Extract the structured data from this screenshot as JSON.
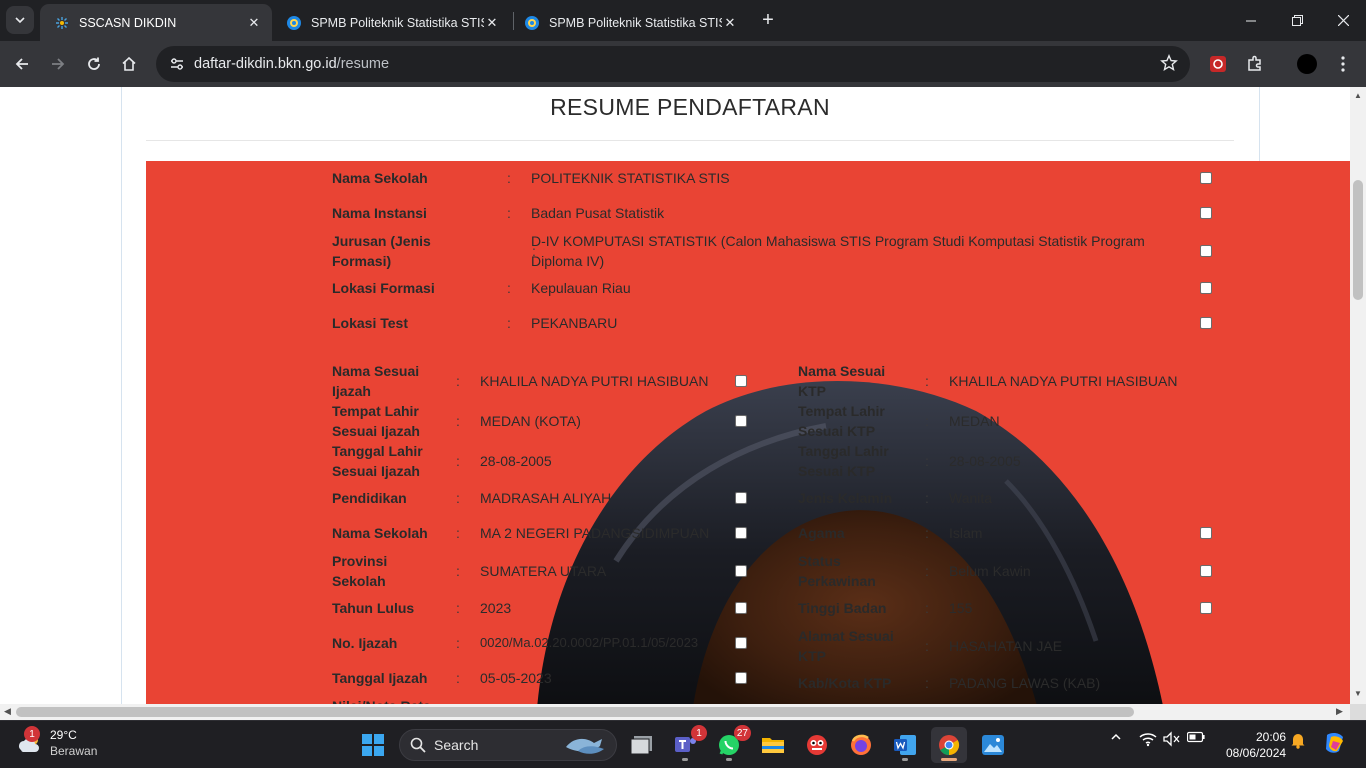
{
  "browser": {
    "tabs": [
      {
        "title": "SSCASN DIKDIN",
        "active": true
      },
      {
        "title": "SPMB Politeknik Statistika STIS",
        "active": false
      },
      {
        "title": "SPMB Politeknik Statistika STIS",
        "active": false
      }
    ],
    "url_host": "daftar-dikdin.bkn.go.id",
    "url_path": "/resume"
  },
  "page": {
    "title": "RESUME PENDAFTARAN",
    "panel_color": "#e94434",
    "top_rows": [
      {
        "label": "Nama Sekolah",
        "value": "POLITEKNIK STATISTIKA STIS"
      },
      {
        "label": "Nama Instansi",
        "value": "Badan Pusat Statistik"
      },
      {
        "label": "Jurusan (Jenis Formasi)",
        "value": "D-IV KOMPUTASI STATISTIK (Calon Mahasiswa STIS Program Studi Komputasi Statistik Program Diploma IV)"
      },
      {
        "label": "Lokasi Formasi",
        "value": "Kepulauan Riau"
      },
      {
        "label": "Lokasi Test",
        "value": "PEKANBARU"
      }
    ],
    "left_rows": [
      {
        "label": "Nama Sesuai Ijazah",
        "value": "KHALILA NADYA PUTRI HASIBUAN"
      },
      {
        "label": "Tempat Lahir Sesuai Ijazah",
        "value": "MEDAN (KOTA)"
      },
      {
        "label": "Tanggal Lahir Sesuai Ijazah",
        "value": "28-08-2005"
      },
      {
        "label": "Pendidikan",
        "value": "MADRASAH ALIYAH"
      },
      {
        "label": "Nama Sekolah",
        "value": "MA 2 NEGERI PADANGSIDIMPUAN"
      },
      {
        "label": "Provinsi Sekolah",
        "value": "SUMATERA UTARA"
      },
      {
        "label": "Tahun Lulus",
        "value": "2023"
      },
      {
        "label": "No. Ijazah",
        "value": "0020/Ma.02.20.0002/PP.01.1/05/2023"
      },
      {
        "label": "Tanggal Ijazah",
        "value": "05-05-2023"
      },
      {
        "label": "Nilai/Nota Rata",
        "value": ""
      }
    ],
    "right_rows": [
      {
        "label": "Nama Sesuai KTP",
        "value": "KHALILA NADYA PUTRI HASIBUAN"
      },
      {
        "label": "Tempat Lahir Sesuai KTP",
        "value": "MEDAN"
      },
      {
        "label": "Tanggal Lahir Sesuai KTP",
        "value": "28-08-2005"
      },
      {
        "label": "Jenis Kelamin",
        "value": "Wanita"
      },
      {
        "label": "Agama",
        "value": "Islam"
      },
      {
        "label": "Status Perkawinan",
        "value": "Belum Kawin"
      },
      {
        "label": "Tinggi Badan",
        "value": "155"
      },
      {
        "label": "Alamat Sesuai KTP",
        "value": "HASAHATAN JAE"
      },
      {
        "label": "Kab/Kota KTP",
        "value": "PADANG LAWAS (KAB)"
      }
    ],
    "separator": ":"
  },
  "taskbar": {
    "weather_temp": "29°C",
    "weather_condition": "Berawan",
    "weather_badge": "1",
    "search_label": "Search",
    "teams_badge": "1",
    "whatsapp_badge": "27",
    "time": "20:06",
    "date": "08/06/2024"
  }
}
